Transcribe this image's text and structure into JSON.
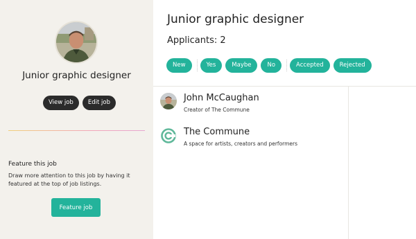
{
  "sidebar": {
    "avatar_icon": "profile-photo",
    "job_title": "Junior graphic designer",
    "view_job_label": "View job",
    "edit_job_label": "Edit job",
    "feature": {
      "title": "Feature this job",
      "description": "Draw more attention to this job by having it featured at the top of job listings.",
      "button_label": "Feature job"
    }
  },
  "main": {
    "title": "Junior graphic designer",
    "applicants_text": "Applicants: 2",
    "filters": [
      "New",
      "Yes",
      "Maybe",
      "No",
      "Accepted",
      "Rejected"
    ],
    "entries": [
      {
        "name": "John McCaughan",
        "subtitle": "Creator of The Commune",
        "icon": "avatar"
      },
      {
        "name": "The Commune",
        "subtitle": "A space for artists, creators and performers",
        "icon": "commune-logo-icon"
      }
    ]
  },
  "colors": {
    "accent": "#23b39b",
    "dark_button": "#2b2b2b",
    "sidebar_bg": "#f3f1ec"
  }
}
